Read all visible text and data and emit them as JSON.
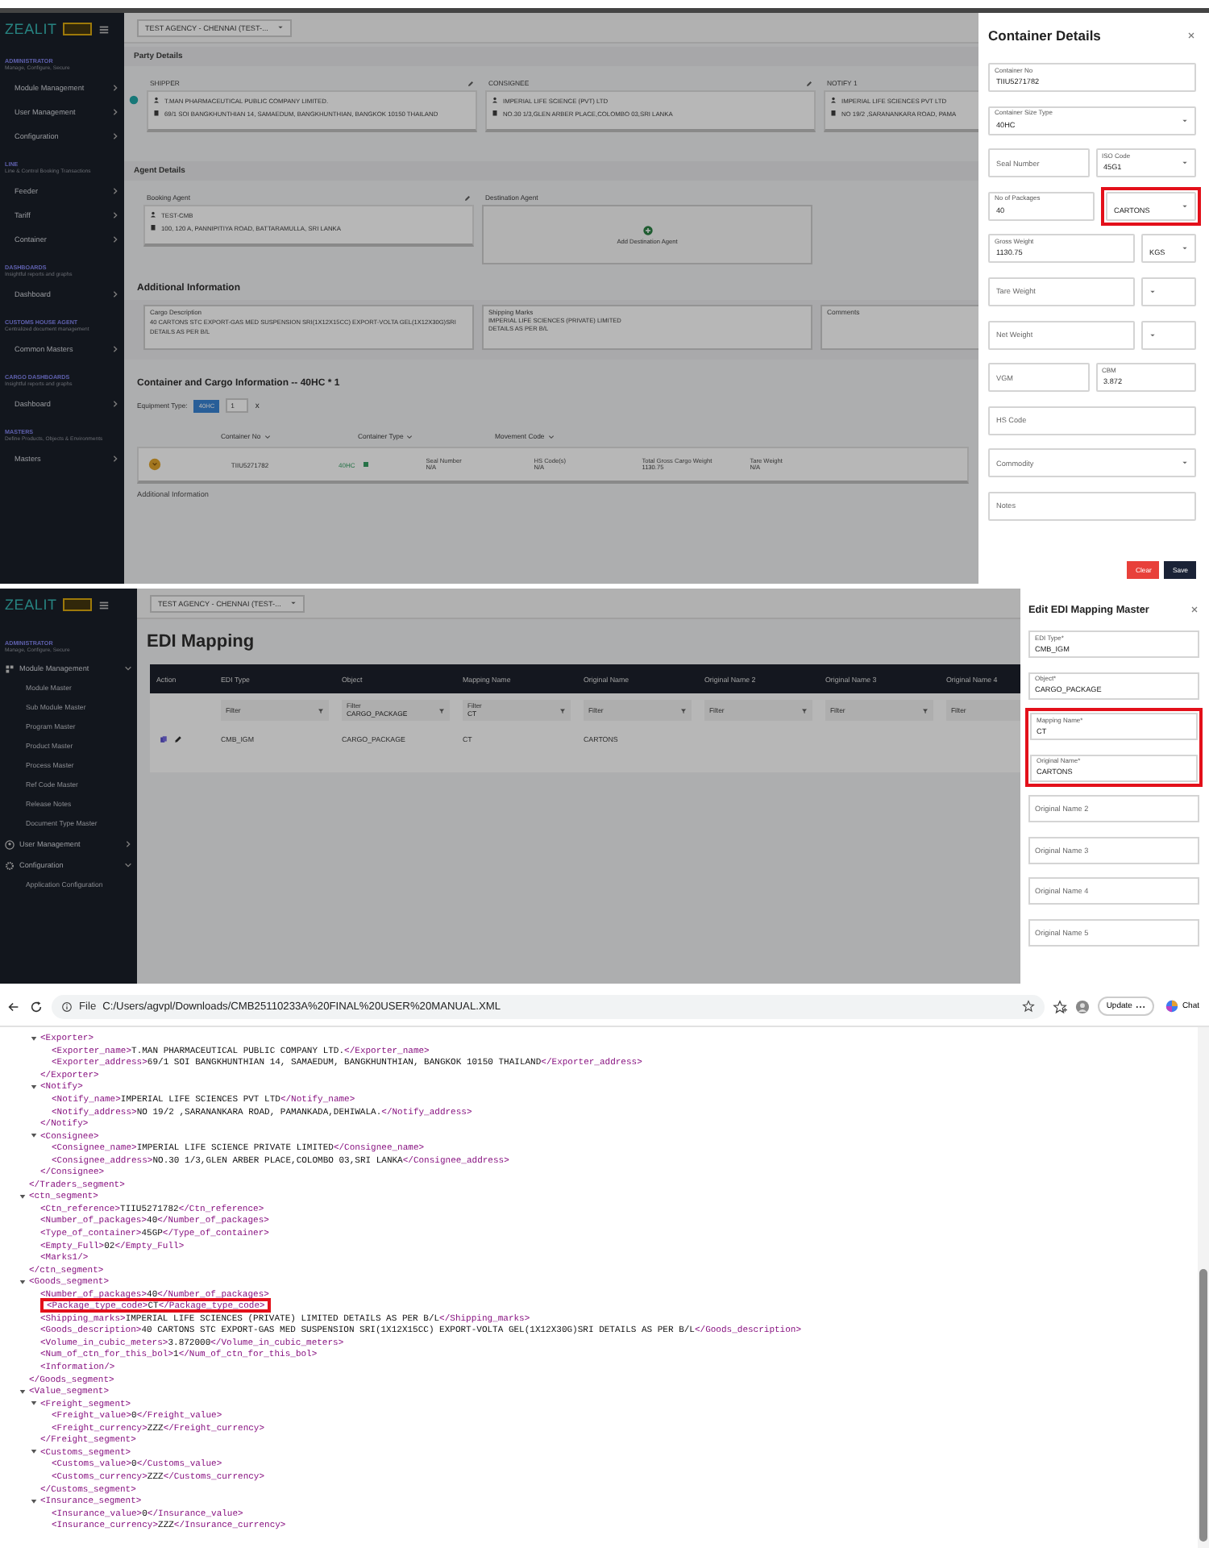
{
  "container_screen": {
    "sidebar": {
      "logo": "ZEALIT",
      "sections": [
        {
          "title": "ADMINISTRATOR",
          "subtitle": "Manage, Configure, Secure",
          "items": [
            {
              "label": "Module Management",
              "expanded": false
            },
            {
              "label": "User Management",
              "expanded": false
            },
            {
              "label": "Configuration",
              "expanded": false
            }
          ]
        },
        {
          "title": "LINE",
          "subtitle": "Line & Control Booking Transactions",
          "items": [
            {
              "label": "Feeder",
              "expanded": false
            },
            {
              "label": "Tariff",
              "expanded": false
            },
            {
              "label": "Container",
              "expanded": false
            }
          ]
        },
        {
          "title": "DASHBOARDS",
          "subtitle": "Insightful reports and graphs",
          "items": [
            {
              "label": "Dashboard",
              "expanded": false
            }
          ]
        },
        {
          "title": "CUSTOMS HOUSE AGENT",
          "subtitle": "Centralized document management",
          "items": [
            {
              "label": "Common Masters",
              "expanded": false
            }
          ]
        },
        {
          "title": "CARGO DASHBOARDS",
          "subtitle": "Insightful reports and graphs",
          "items": [
            {
              "label": "Dashboard",
              "expanded": false
            }
          ]
        },
        {
          "title": "MASTERS",
          "subtitle": "Define Products, Objects & Environments",
          "items": [
            {
              "label": "Masters",
              "expanded": false
            }
          ]
        }
      ]
    },
    "agency_select": "TEST AGENCY - CHENNAI (TEST-...",
    "party_details": {
      "title": "Party Details",
      "parties": [
        {
          "role": "SHIPPER",
          "name": "T.MAN PHARMACEUTICAL PUBLIC COMPANY LIMITED.",
          "address": "69/1 SOI BANGKHUNTHIAN 14, SAMAEDUM, BANGKHUNTHIAN, BANGKOK 10150 THAILAND"
        },
        {
          "role": "CONSIGNEE",
          "name": "IMPERIAL LIFE SCIENCE (PVT) LTD",
          "address": "NO.30 1/3,GLEN ARBER PLACE,COLOMBO 03,SRI LANKA"
        },
        {
          "role": "NOTIFY 1",
          "name": "IMPERIAL LIFE SCIENCES PVT LTD",
          "address": "NO 19/2 ,SARANANKARA ROAD, PAMA"
        }
      ]
    },
    "agent_details": {
      "title": "Agent Details",
      "booking": {
        "role": "Booking Agent",
        "name": "TEST-CMB",
        "address": "100, 120 A, PANNIPITIYA ROAD, BATTARAMULLA, SRI LANKA"
      },
      "destination": {
        "role": "Destination Agent",
        "action": "Add Destination Agent"
      }
    },
    "additional_information": {
      "title": "Additional Information",
      "cargo_description": {
        "label": "Cargo Description",
        "value": "40 CARTONS STC EXPORT-GAS MED SUSPENSION SRI(1X12X15CC) EXPORT-VOLTA GEL(1X12X30G)SRI DETAILS AS PER B/L"
      },
      "shipping_marks": {
        "label": "Shipping Marks",
        "lines": [
          "IMPERIAL LIFE SCIENCES (PRIVATE) LIMITED",
          "DETAILS AS PER B/L"
        ]
      },
      "comments": {
        "placeholder": "Comments"
      }
    },
    "container_cargo": {
      "title": "Container and Cargo Information -- 40HC * 1",
      "equipment_label": "Equipment Type:",
      "equipment_chip": "40HC",
      "equipment_count": "1",
      "remove": "x",
      "columns": [
        "Container No",
        "Container Type",
        "Movement Code"
      ],
      "row": {
        "container_no": "TIIU5271782",
        "container_type": "40HC",
        "details": [
          {
            "label": "Seal Number",
            "value": "N/A"
          },
          {
            "label": "HS Code(s)",
            "value": "N/A"
          },
          {
            "label": "Total Gross Cargo Weight",
            "value": "1130.75"
          },
          {
            "label": "Tare Weight",
            "value": "N/A"
          }
        ]
      }
    },
    "next_section": "Additional Information",
    "drawer": {
      "title": "Container Details",
      "rows": [
        [
          {
            "kind": "text",
            "label": "Container No",
            "value": "TIIU5271782"
          }
        ],
        [
          {
            "kind": "select",
            "label": "Container Size Type",
            "value": "40HC"
          }
        ],
        [
          {
            "kind": "text",
            "placeholder": "Seal Number"
          },
          {
            "kind": "select",
            "label": "ISO Code",
            "value": "45G1"
          }
        ],
        [
          {
            "kind": "text",
            "label": "No of Packages",
            "value": "40"
          },
          {
            "kind": "select",
            "value": "CARTONS",
            "highlighted": true
          }
        ],
        [
          {
            "kind": "text",
            "label": "Gross Weight",
            "value": "1130.75"
          },
          {
            "kind": "unit",
            "value": "KGS"
          }
        ],
        [
          {
            "kind": "text",
            "placeholder": "Tare Weight"
          },
          {
            "kind": "unit"
          }
        ],
        [
          {
            "kind": "text",
            "placeholder": "Net Weight"
          },
          {
            "kind": "unit"
          }
        ],
        [
          {
            "kind": "text",
            "placeholder": "VGM"
          },
          {
            "kind": "text",
            "label": "CBM",
            "value": "3.872"
          }
        ],
        [
          {
            "kind": "text",
            "placeholder": "HS Code"
          }
        ],
        [
          {
            "kind": "select",
            "placeholder": "Commodity"
          }
        ],
        [
          {
            "kind": "text",
            "placeholder": "Notes"
          }
        ]
      ],
      "buttons": [
        {
          "label": "Clear",
          "kind": "danger"
        },
        {
          "label": "Save",
          "kind": "primary"
        }
      ]
    }
  },
  "edi_screen": {
    "sidebar": {
      "logo": "ZEALIT",
      "title": "ADMINISTRATOR",
      "subtitle": "Manage, Configure, Secure",
      "items": [
        {
          "label": "Module Management",
          "expanded": true,
          "children": [
            {
              "label": "Module Master"
            },
            {
              "label": "Sub Module Master"
            },
            {
              "label": "Program Master"
            },
            {
              "label": "Product Master"
            },
            {
              "label": "Process Master"
            },
            {
              "label": "Ref Code Master"
            },
            {
              "label": "Release Notes"
            },
            {
              "label": "Document Type Master"
            }
          ]
        },
        {
          "label": "User Management",
          "expanded": false
        },
        {
          "label": "Configuration",
          "expanded": true,
          "children": [
            {
              "label": "Application Configuration"
            }
          ]
        }
      ]
    },
    "agency_select": "TEST AGENCY - CHENNAI (TEST-...",
    "title": "EDI Mapping",
    "table": {
      "columns": [
        "Action",
        "EDI Type",
        "Object",
        "Mapping Name",
        "Original Name",
        "Original Name 2",
        "Original Name 3",
        "Original Name 4"
      ],
      "filters": [
        {
          "placeholder": "Filter"
        },
        {
          "label": "Filter",
          "value": "CARGO_PACKAGE"
        },
        {
          "label": "Filter",
          "value": "CT"
        },
        {
          "placeholder": "Filter"
        },
        {
          "placeholder": "Filter"
        },
        {
          "placeholder": "Filter"
        },
        {
          "placeholder": "Filter"
        }
      ],
      "rows": [
        {
          "cells": [
            "",
            "CMB_IGM",
            "CARGO_PACKAGE",
            "CT",
            "CARTONS"
          ]
        }
      ]
    },
    "drawer": {
      "title": "Edit EDI Mapping Master",
      "fields": [
        {
          "label": "EDI Type*",
          "value": "CMB_IGM"
        },
        {
          "label": "Object*",
          "value": "CARGO_PACKAGE"
        },
        {
          "label": "Mapping Name*",
          "value": "CT",
          "highlighted": true
        },
        {
          "label": "Original Name*",
          "value": "CARTONS",
          "highlighted": true
        },
        {
          "placeholder": "Original Name 2"
        },
        {
          "placeholder": "Original Name 3"
        },
        {
          "placeholder": "Original Name 4"
        },
        {
          "placeholder": "Original Name 5"
        }
      ]
    }
  },
  "browser": {
    "scheme": "File",
    "url": "C:/Users/agvpl/Downloads/CMB25110233A%20FINAL%20USER%20MANUAL.XML",
    "update_button": "Update",
    "chat_button": "Chat",
    "xml": {
      "nodes": [
        {
          "children": [
            {
              "open": "<Exporter>",
              "expanded": true,
              "children": [
                {
                  "open": "<Exporter_name>",
                  "value": "T.MAN PHARMACEUTICAL PUBLIC COMPANY LTD.",
                  "close": "</Exporter_name>"
                },
                {
                  "open": "<Exporter_address>",
                  "value": "69/1 SOI BANGKHUNTHIAN 14, SAMAEDUM, BANGKHUNTHIAN, BANGKOK 10150 THAILAND",
                  "close": "</Exporter_address>"
                }
              ],
              "close": "</Exporter>"
            },
            {
              "open": "<Notify>",
              "expanded": true,
              "children": [
                {
                  "open": "<Notify_name>",
                  "value": "IMPERIAL LIFE SCIENCES PVT LTD",
                  "close": "</Notify_name>"
                },
                {
                  "open": "<Notify_address>",
                  "value": "NO 19/2 ,SARANANKARA ROAD, PAMANKADA,DEHIWALA.",
                  "close": "</Notify_address>"
                }
              ],
              "close": "</Notify>"
            },
            {
              "open": "<Consignee>",
              "expanded": true,
              "children": [
                {
                  "open": "<Consignee_name>",
                  "value": "IMPERIAL LIFE SCIENCE PRIVATE LIMITED",
                  "close": "</Consignee_name>"
                },
                {
                  "open": "<Consignee_address>",
                  "value": "NO.30 1/3,GLEN ARBER PLACE,COLOMBO 03,SRI LANKA",
                  "close": "</Consignee_address>"
                }
              ],
              "close": "</Consignee>"
            }
          ],
          "close": "</Traders_segment>"
        },
        {
          "open": "<ctn_segment>",
          "expanded": true,
          "children": [
            {
              "open": "<Ctn_reference>",
              "value": "TIIU5271782",
              "close": "</Ctn_reference>"
            },
            {
              "open": "<Number_of_packages>",
              "value": "40",
              "close": "</Number_of_packages>"
            },
            {
              "open": "<Type_of_container>",
              "value": "45GP",
              "close": "</Type_of_container>"
            },
            {
              "open": "<Empty_Full>",
              "value": "02",
              "close": "</Empty_Full>"
            },
            {
              "open": "<Marks1/>"
            }
          ],
          "close": "</ctn_segment>"
        },
        {
          "open": "<Goods_segment>",
          "expanded": true,
          "children": [
            {
              "open": "<Number_of_packages>",
              "value": "40",
              "close": "</Number_of_packages>"
            },
            {
              "open": "<Package_type_code>",
              "value": "CT",
              "close": "</Package_type_code>",
              "highlighted": true
            },
            {
              "open": "<Shipping_marks>",
              "value": "IMPERIAL LIFE SCIENCES (PRIVATE) LIMITED DETAILS AS PER B/L",
              "close": "</Shipping_marks>"
            },
            {
              "open": "<Goods_description>",
              "value": "40 CARTONS STC EXPORT-GAS MED SUSPENSION SRI(1X12X15CC) EXPORT-VOLTA GEL(1X12X30G)SRI DETAILS AS PER B/L",
              "close": "</Goods_description>"
            },
            {
              "open": "<Volume_in_cubic_meters>",
              "value": "3.872000",
              "close": "</Volume_in_cubic_meters>"
            },
            {
              "open": "<Num_of_ctn_for_this_bol>",
              "value": "1",
              "close": "</Num_of_ctn_for_this_bol>"
            },
            {
              "open": "<Information/>"
            }
          ],
          "close": "</Goods_segment>"
        },
        {
          "open": "<Value_segment>",
          "expanded": true,
          "children": [
            {
              "open": "<Freight_segment>",
              "expanded": true,
              "children": [
                {
                  "open": "<Freight_value>",
                  "value": "0",
                  "close": "</Freight_value>"
                },
                {
                  "open": "<Freight_currency>",
                  "value": "ZZZ",
                  "close": "</Freight_currency>"
                }
              ],
              "close": "</Freight_segment>"
            },
            {
              "open": "<Customs_segment>",
              "expanded": true,
              "children": [
                {
                  "open": "<Customs_value>",
                  "value": "0",
                  "close": "</Customs_value>"
                },
                {
                  "open": "<Customs_currency>",
                  "value": "ZZZ",
                  "close": "</Customs_currency>"
                }
              ],
              "close": "</Customs_segment>"
            },
            {
              "open": "<Insurance_segment>",
              "expanded": true,
              "children": [
                {
                  "open": "<Insurance_value>",
                  "value": "0",
                  "close": "</Insurance_value>"
                },
                {
                  "open": "<Insurance_currency>",
                  "value": "ZZZ",
                  "close": "</Insurance_currency>"
                }
              ]
            }
          ]
        }
      ]
    }
  }
}
